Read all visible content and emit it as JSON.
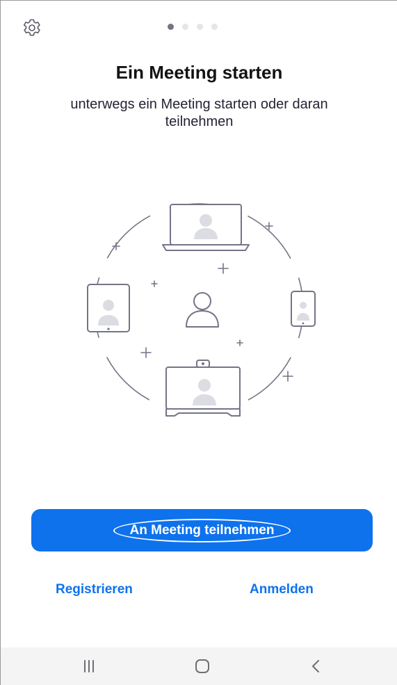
{
  "header": {
    "settings_icon": "gear-icon",
    "page_indicator": {
      "count": 4,
      "active_index": 0
    }
  },
  "content": {
    "title": "Ein Meeting starten",
    "subtitle": "unterwegs ein Meeting starten oder daran teilnehmen",
    "illustration": "devices-connected-illustration"
  },
  "actions": {
    "join_label": "An Meeting teilnehmen",
    "register_label": "Registrieren",
    "signin_label": "Anmelden"
  },
  "navbar": {
    "recent_icon": "recent-apps-icon",
    "home_icon": "home-icon",
    "back_icon": "back-icon"
  },
  "colors": {
    "accent": "#0e72ed",
    "title": "#131316",
    "navbar_bg": "#f4f4f5"
  }
}
